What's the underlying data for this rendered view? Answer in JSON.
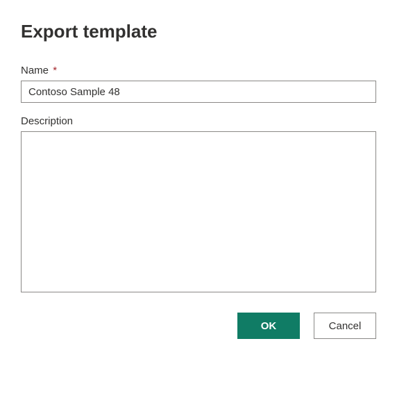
{
  "dialog": {
    "title": "Export template"
  },
  "fields": {
    "name": {
      "label": "Name",
      "required_mark": "*",
      "value": "Contoso Sample 48"
    },
    "description": {
      "label": "Description",
      "value": ""
    }
  },
  "buttons": {
    "ok": "OK",
    "cancel": "Cancel"
  },
  "colors": {
    "primary": "#107C65",
    "required": "#A4262C",
    "border": "#8A8886",
    "text": "#323130"
  }
}
